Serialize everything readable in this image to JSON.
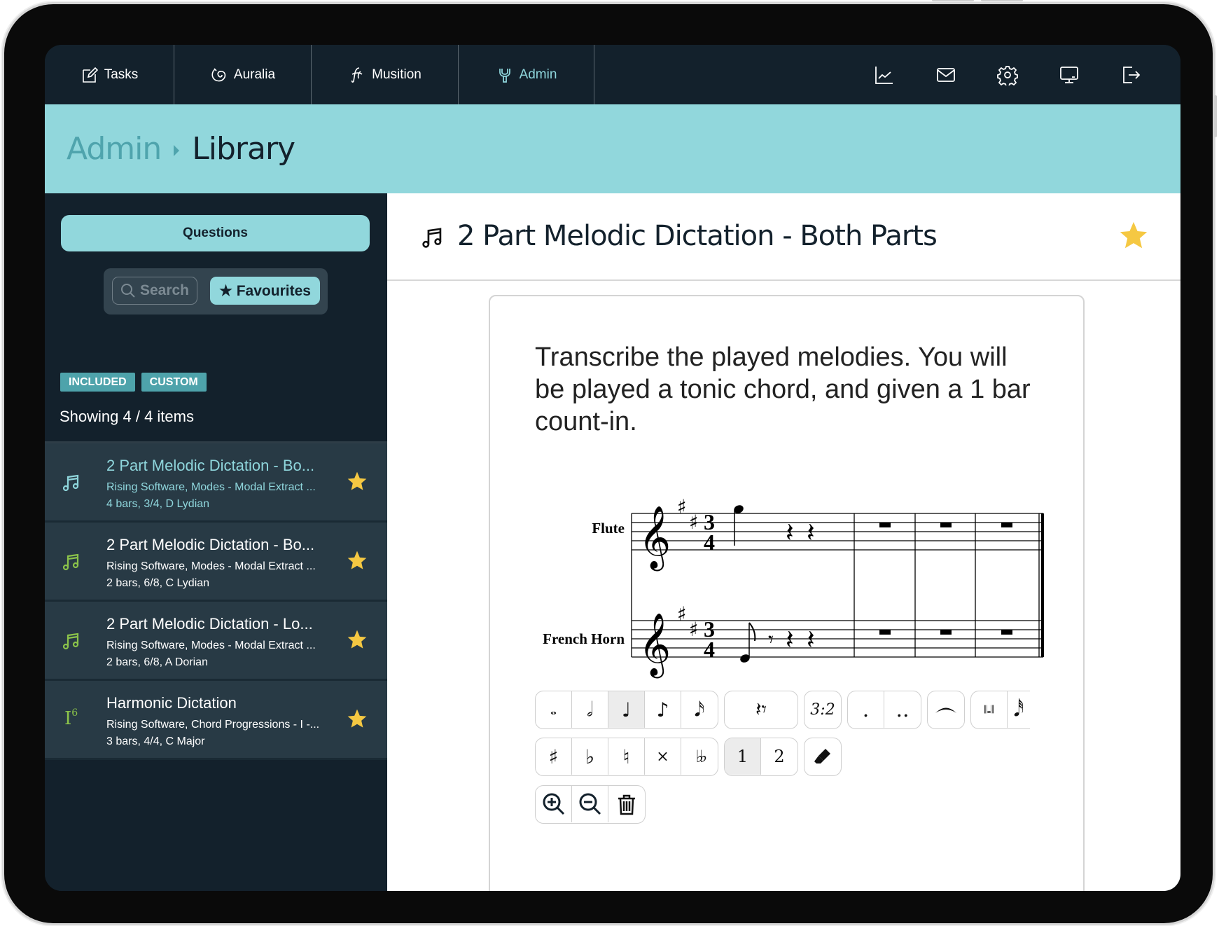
{
  "nav": {
    "tabs": [
      {
        "label": "Tasks",
        "icon": "edit-icon",
        "active": false
      },
      {
        "label": "Auralia",
        "icon": "auralia-logo-icon",
        "active": false
      },
      {
        "label": "Musition",
        "icon": "musition-logo-icon",
        "active": false
      },
      {
        "label": "Admin",
        "icon": "wrench-icon",
        "active": true
      }
    ],
    "right_icons": [
      "chart-icon",
      "mail-icon",
      "gear-icon",
      "monitor-icon",
      "logout-icon"
    ]
  },
  "breadcrumb": {
    "parent": "Admin",
    "current": "Library"
  },
  "sidebar": {
    "questions_label": "Questions",
    "search_label": "Search",
    "favourites_label": "★ Favourites",
    "tags": [
      "INCLUDED",
      "CUSTOM"
    ],
    "showing_text": "Showing 4 / 4 items",
    "items": [
      {
        "title": "2 Part Melodic Dictation - Bo...",
        "subtitle": "Rising Software, Modes - Modal Extract ...",
        "meta": "4 bars, 3/4, D Lydian",
        "icon": "music-note-icon",
        "favourite": true,
        "selected": true
      },
      {
        "title": "2 Part Melodic Dictation - Bo...",
        "subtitle": "Rising Software, Modes - Modal Extract ...",
        "meta": "2 bars, 6/8, C Lydian",
        "icon": "music-note-icon",
        "favourite": true,
        "selected": false
      },
      {
        "title": "2 Part Melodic Dictation - Lo...",
        "subtitle": "Rising Software, Modes - Modal Extract ...",
        "meta": "2 bars, 6/8, A Dorian",
        "icon": "music-note-icon",
        "favourite": true,
        "selected": false
      },
      {
        "title": "Harmonic Dictation",
        "subtitle": "Rising Software, Chord Progressions - I -...",
        "meta": "3 bars, 4/4, C Major",
        "icon": "chord-numeral-icon",
        "icon_text": "I",
        "icon_sup": "6",
        "favourite": true,
        "selected": false
      }
    ]
  },
  "main": {
    "title": "2 Part Melodic Dictation - Both Parts",
    "favourite": true,
    "instructions": "Transcribe the played melodies. You will be played a tonic chord, and given a 1 bar count-in.",
    "score": {
      "parts": [
        "Flute",
        "French Horn"
      ],
      "key_signature": "2 sharps",
      "time_signature": "3/4",
      "bars": 4
    },
    "toolbar": {
      "durations": [
        "whole",
        "half",
        "quarter",
        "eighth",
        "sixteenth"
      ],
      "duration_selected": "quarter",
      "rest_label": "rest",
      "tuplet_label": "3:2",
      "dots": [
        ".",
        ".."
      ],
      "accidentals": [
        "♯",
        "♭",
        "♮",
        "×",
        "♭♭"
      ],
      "voices": [
        "1",
        "2"
      ],
      "voice_selected": "1"
    }
  },
  "colors": {
    "nav_bg": "#13212c",
    "accent": "#91d7dc",
    "accent_dark": "#4fa4ad",
    "star": "#f5c842",
    "icon_green": "#8bc34a"
  }
}
